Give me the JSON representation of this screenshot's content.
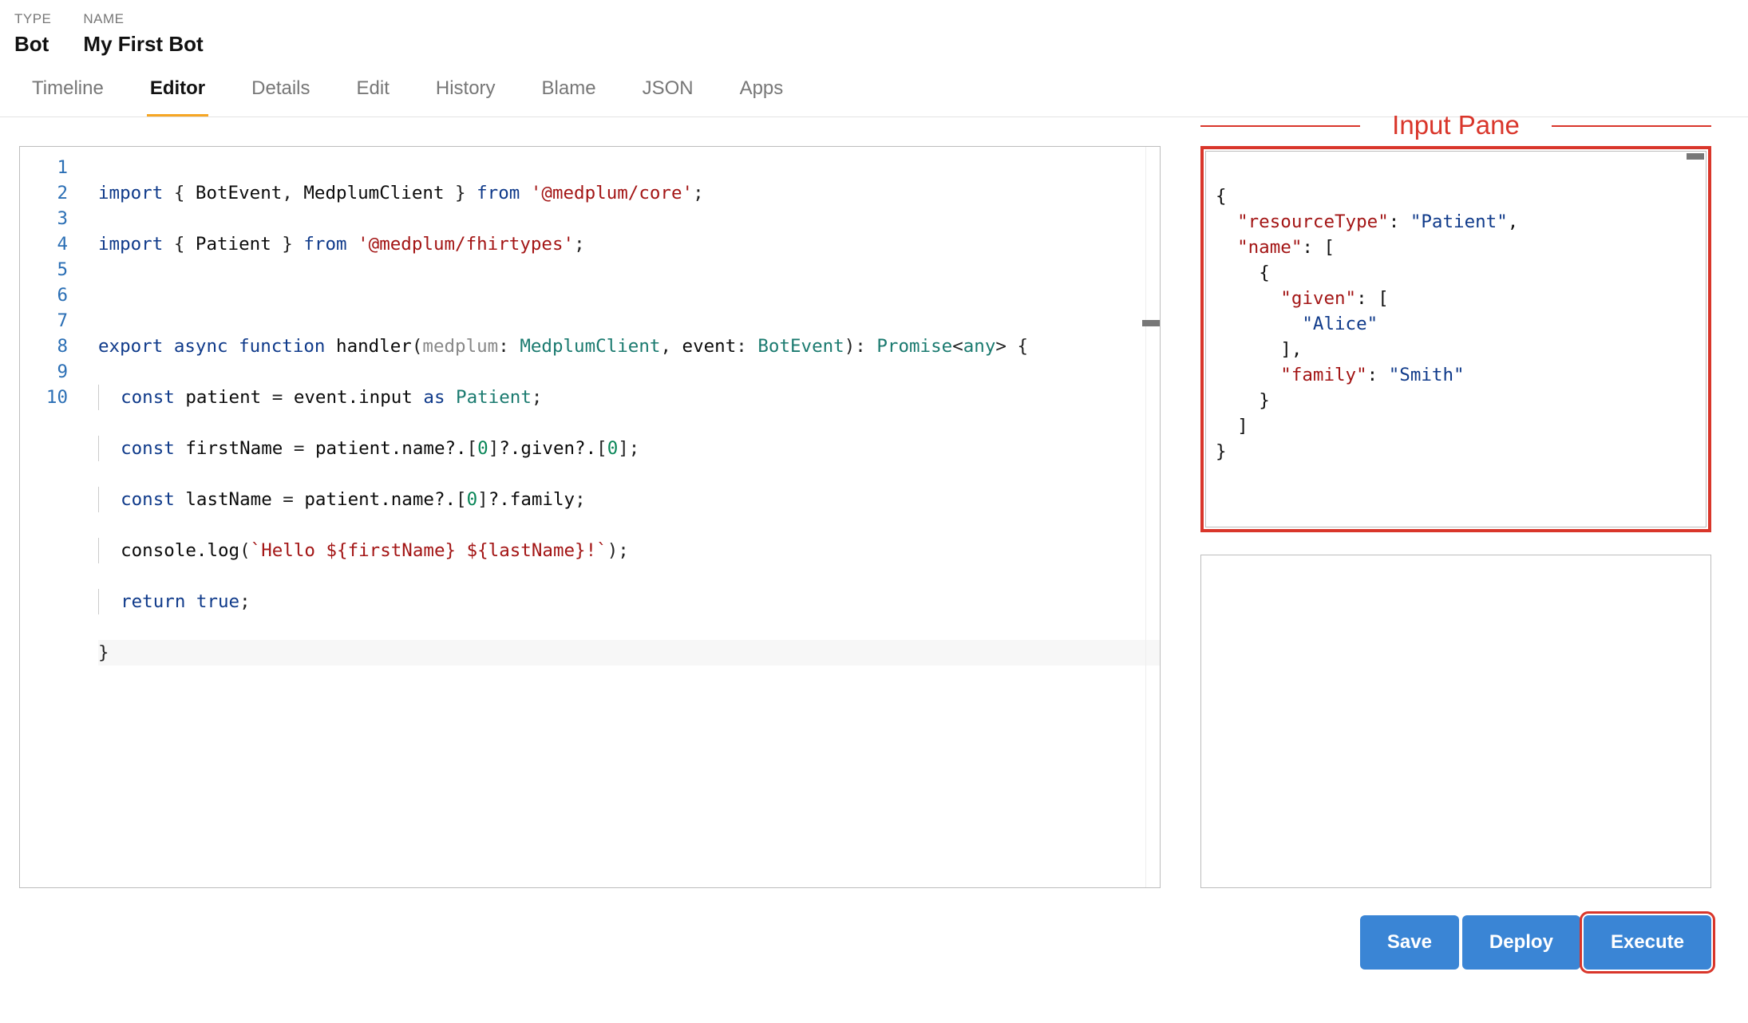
{
  "header": {
    "typeLabel": "TYPE",
    "typeValue": "Bot",
    "nameLabel": "NAME",
    "nameValue": "My First Bot"
  },
  "tabs": [
    {
      "label": "Timeline",
      "active": false
    },
    {
      "label": "Editor",
      "active": true
    },
    {
      "label": "Details",
      "active": false
    },
    {
      "label": "Edit",
      "active": false
    },
    {
      "label": "History",
      "active": false
    },
    {
      "label": "Blame",
      "active": false
    },
    {
      "label": "JSON",
      "active": false
    },
    {
      "label": "Apps",
      "active": false
    }
  ],
  "editor": {
    "lineNumbers": [
      "1",
      "2",
      "3",
      "4",
      "5",
      "6",
      "7",
      "8",
      "9",
      "10"
    ],
    "code": {
      "line1": "import { BotEvent, MedplumClient } from '@medplum/core';",
      "line2": "import { Patient } from '@medplum/fhirtypes';",
      "line3": "",
      "line4": "export async function handler(medplum: MedplumClient, event: BotEvent): Promise<any> {",
      "line5": "  const patient = event.input as Patient;",
      "line6": "  const firstName = patient.name?.[0]?.given?.[0];",
      "line7": "  const lastName = patient.name?.[0]?.family;",
      "line8": "  console.log(`Hello ${firstName} ${lastName}!`);",
      "line9": "  return true;",
      "line10": "}"
    }
  },
  "annotation": {
    "inputPaneLabel": "Input Pane"
  },
  "inputPane": {
    "json": {
      "resourceType": "Patient",
      "name": [
        {
          "given": [
            "Alice"
          ],
          "family": "Smith"
        }
      ]
    },
    "display": {
      "l1": "{",
      "l2_k": "\"resourceType\"",
      "l2_v": "\"Patient\"",
      "l3_k": "\"name\"",
      "l5_k": "\"given\"",
      "l6_v": "\"Alice\"",
      "l8_k": "\"family\"",
      "l8_v": "\"Smith\"",
      "close": "}"
    }
  },
  "buttons": {
    "save": "Save",
    "deploy": "Deploy",
    "execute": "Execute"
  }
}
